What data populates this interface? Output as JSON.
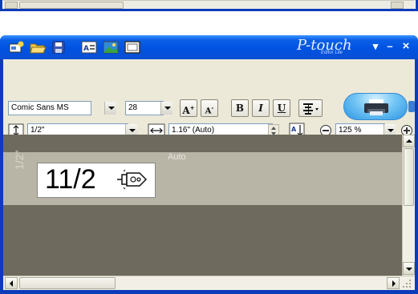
{
  "window": {
    "title_logo": "P-touch",
    "title_logo_sub": "Editor Lite",
    "minimize_label": "–",
    "close_label": "×",
    "menu_arrow": "▾"
  },
  "toolbar": {
    "font_name": "Comic Sans MS",
    "font_size": "28",
    "grow_font_label": "A",
    "shrink_font_label": "A",
    "bold_label": "B",
    "italic_label": "I",
    "underline_label": "U",
    "tape_width": "1/2\"",
    "label_length": "1.16\" (Auto)",
    "zoom": "125 %"
  },
  "canvas": {
    "label_text": "11/2",
    "tape_width_marker": "1/2\"",
    "length_marker": "Auto"
  },
  "icons": [
    "new-label-icon",
    "open-folder-icon",
    "save-icon",
    "text-icon",
    "image-icon",
    "frame-icon",
    "align-icon",
    "print-icon",
    "tape-width-icon",
    "label-length-icon",
    "vertical-text-icon",
    "zoom-out-icon",
    "zoom-in-icon",
    "cable-connector-icon"
  ],
  "colors": {
    "titlebar": "#0053e1",
    "toolbar_bg": "#ece9d8",
    "canvas_bg": "#6e6b5e",
    "print_button": "#73c6f4"
  }
}
